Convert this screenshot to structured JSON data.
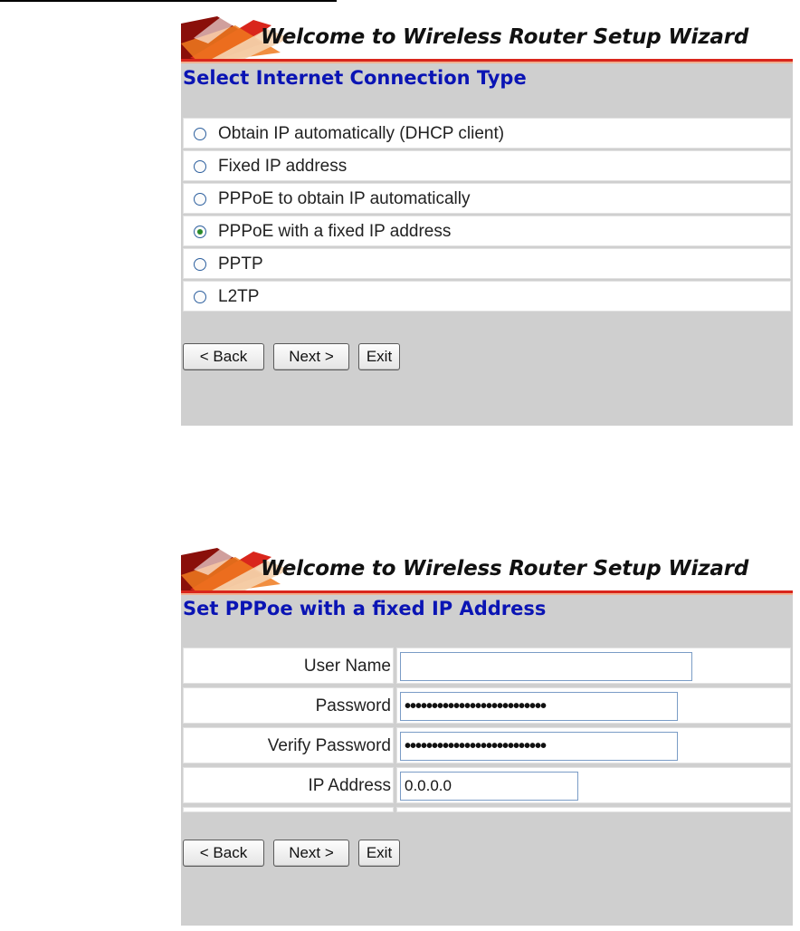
{
  "wizard_title": "Welcome to Wireless Router Setup Wizard",
  "colors": {
    "heading_blue": "#0a14b4",
    "panel_gray": "#cfcfcf",
    "banner_accent": "#d9261c"
  },
  "panel1": {
    "heading": "Select Internet Connection Type",
    "options": [
      {
        "label": "Obtain IP automatically (DHCP client)",
        "checked": false
      },
      {
        "label": "Fixed IP address",
        "checked": false
      },
      {
        "label": "PPPoE to obtain IP automatically",
        "checked": false
      },
      {
        "label": "PPPoE with a fixed IP address",
        "checked": true
      },
      {
        "label": "PPTP",
        "checked": false
      },
      {
        "label": "L2TP",
        "checked": false
      }
    ],
    "buttons": {
      "back": "< Back",
      "next": "Next >",
      "exit": "Exit"
    }
  },
  "panel2": {
    "heading": "Set PPPoe with a fixed IP Address",
    "fields": {
      "user_name": {
        "label": "User Name",
        "value": ""
      },
      "password": {
        "label": "Password",
        "value": "••••••••••••••••••••••••••"
      },
      "verify_password": {
        "label": "Verify Password",
        "value": "••••••••••••••••••••••••••"
      },
      "ip_address": {
        "label": "IP Address",
        "value": "0.0.0.0"
      }
    },
    "buttons": {
      "back": "< Back",
      "next": "Next >",
      "exit": "Exit"
    }
  }
}
